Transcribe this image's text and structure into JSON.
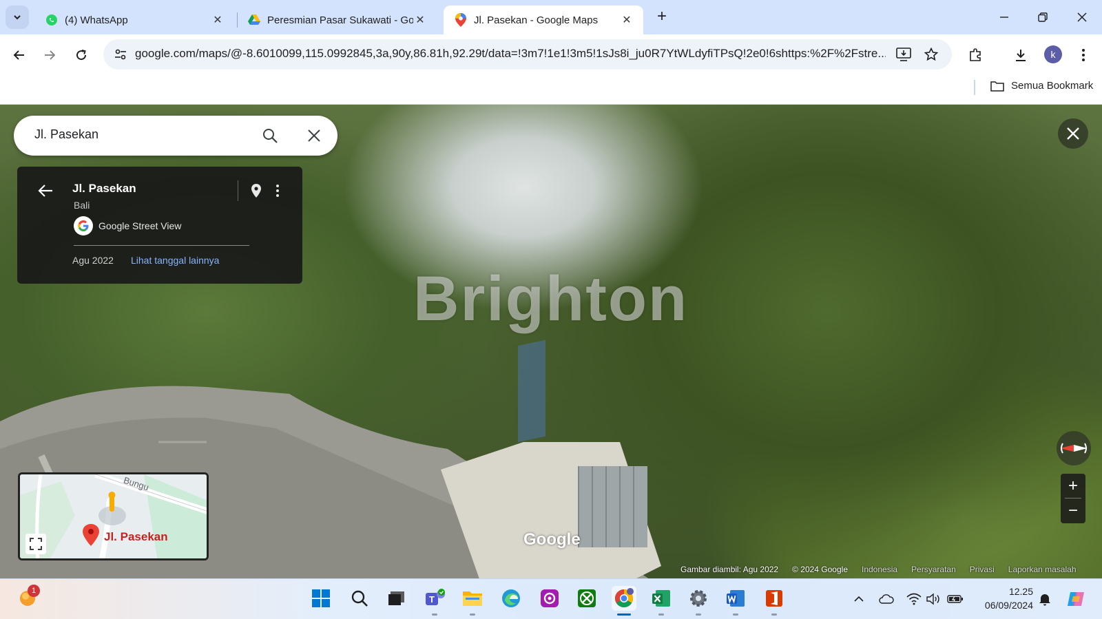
{
  "browser": {
    "tabs": [
      {
        "title": "(4) WhatsApp",
        "icon": "whatsapp-icon",
        "active": false
      },
      {
        "title": "Peresmian Pasar Sukawati - Goo",
        "icon": "google-drive-icon",
        "active": false
      },
      {
        "title": "Jl. Pasekan - Google Maps",
        "icon": "google-maps-icon",
        "active": true
      }
    ],
    "new_tab_label": "+",
    "url": "google.com/maps/@-8.6010099,115.0992845,3a,90y,86.81h,92.29t/data=!3m7!1e1!3m5!1sJs8i_ju0R7YtWLdyfiTPsQ!2e0!6shttps:%2F%2Fstre...",
    "profile_initial": "k",
    "bookmarks_all_label": "Semua Bookmark"
  },
  "maps": {
    "search": {
      "query": "Jl. Pasekan"
    },
    "place_card": {
      "title": "Jl. Pasekan",
      "subtitle": "Bali",
      "source": "Google Street View",
      "date": "Agu 2022",
      "more_dates_link": "Lihat tanggal lainnya"
    },
    "watermark": "Brighton",
    "google_mark": "Google",
    "minimap": {
      "road_label": "Bungu",
      "place_label": "Jl. Pasekan"
    },
    "zoom_in": "+",
    "zoom_out": "−",
    "attribution": {
      "captured": "Gambar diambil: Agu 2022",
      "copyright": "© 2024 Google",
      "links": [
        "Indonesia",
        "Persyaratan",
        "Privasi",
        "Laporkan masalah"
      ]
    }
  },
  "taskbar": {
    "notification_count": "1",
    "time": "12.25",
    "date": "06/09/2024"
  },
  "colors": {
    "tabstrip": "#d3e3fd",
    "link": "#8ab4f8",
    "maps_red": "#ea4335"
  }
}
